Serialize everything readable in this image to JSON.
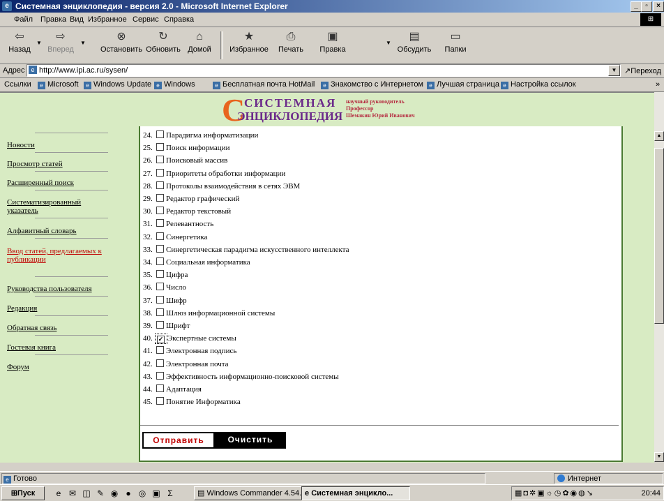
{
  "window": {
    "title": "Системная энциклопедия - версия 2.0 - Microsoft Internet Explorer"
  },
  "menu": [
    "Файл",
    "Правка",
    "Вид",
    "Избранное",
    "Сервис",
    "Справка"
  ],
  "toolbar": {
    "back": "Назад",
    "forward": "Вперед",
    "stop": "Остановить",
    "refresh": "Обновить",
    "home": "Домой",
    "favorites": "Избранное",
    "print": "Печать",
    "edit": "Правка",
    "discuss": "Обсудить",
    "folders": "Папки"
  },
  "address": {
    "label": "Адрес",
    "url": "http://www.ipi.ac.ru/sysen/",
    "go": "Переход"
  },
  "links": {
    "label": "Ссылки",
    "items": [
      "Microsoft",
      "Windows Update",
      "Windows",
      "Бесплатная почта HotMail",
      "Знакомство с Интернетом",
      "Лучшая страница",
      "Настройка ссылок"
    ]
  },
  "logo": {
    "line1": "СИСТЕМНАЯ",
    "line2": "ЭНЦИКЛОПЕДИЯ",
    "side1": "научный руководитель",
    "side2": "Профессор",
    "side3": "Шемакин Юрий Иванович"
  },
  "sidebar": [
    "Новости",
    "Просмотр статей",
    "Расширенный поиск",
    "Систематизированный указатель",
    "Алфавитный словарь",
    "Ввод статей, предлагаемых к публикации",
    "Руководства пользователя",
    "Редакция",
    "Обратная связь",
    "Гостевая книга",
    "Форум"
  ],
  "items": [
    {
      "num": "24.",
      "label": "Парадигма информатизации",
      "checked": false
    },
    {
      "num": "25.",
      "label": "Поиск информации",
      "checked": false
    },
    {
      "num": "26.",
      "label": "Поисковый массив",
      "checked": false
    },
    {
      "num": "27.",
      "label": "Приоритеты обработки информации",
      "checked": false
    },
    {
      "num": "28.",
      "label": "Протоколы взаимодействия в сетях ЭВМ",
      "checked": false
    },
    {
      "num": "29.",
      "label": "Редактор графический",
      "checked": false
    },
    {
      "num": "30.",
      "label": "Редактор текстовый",
      "checked": false
    },
    {
      "num": "31.",
      "label": "Релевантность",
      "checked": false
    },
    {
      "num": "32.",
      "label": "Синергетика",
      "checked": false
    },
    {
      "num": "33.",
      "label": "Синергетическая парадигма искусственного интеллекта",
      "checked": false
    },
    {
      "num": "34.",
      "label": "Социальная информатика",
      "checked": false
    },
    {
      "num": "35.",
      "label": "Цифра",
      "checked": false
    },
    {
      "num": "36.",
      "label": "Число",
      "checked": false
    },
    {
      "num": "37.",
      "label": "Шифр",
      "checked": false
    },
    {
      "num": "38.",
      "label": "Шлюз информационной системы",
      "checked": false
    },
    {
      "num": "39.",
      "label": "Шрифт",
      "checked": false
    },
    {
      "num": "40.",
      "label": "Экспертные системы",
      "checked": true
    },
    {
      "num": "41.",
      "label": "Электронная подпись",
      "checked": false
    },
    {
      "num": "42.",
      "label": "Электронная почта",
      "checked": false
    },
    {
      "num": "43.",
      "label": "Эффективность информационно-поисковой системы",
      "checked": false
    },
    {
      "num": "44.",
      "label": "Адаптация",
      "checked": false
    },
    {
      "num": "45.",
      "label": "Понятие Информатика",
      "checked": false
    }
  ],
  "buttons": {
    "send": "Отправить",
    "clear": "Очистить"
  },
  "status": {
    "text": "Готово",
    "zone": "Интернет"
  },
  "taskbar": {
    "start": "Пуск",
    "tasks": [
      "Windows Commander 4.54...",
      "Системная энцикло..."
    ],
    "clock": "20:44"
  },
  "colors": {
    "page_bg": "#d8ebc3",
    "panel_border": "#4a7a32",
    "logo_purple": "#6b2a8a",
    "logo_orange": "#e8641e",
    "active_link": "#c00000"
  }
}
